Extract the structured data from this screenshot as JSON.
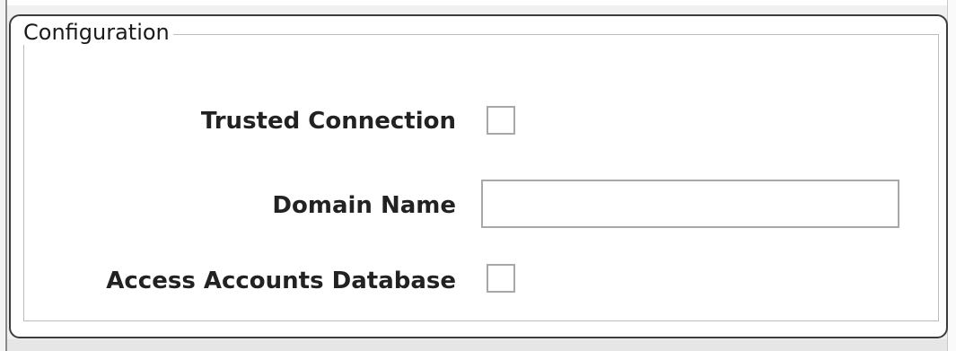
{
  "group": {
    "title": "Configuration"
  },
  "fields": {
    "trusted_connection": {
      "label": "Trusted Connection",
      "checked": false
    },
    "domain_name": {
      "label": "Domain Name",
      "value": ""
    },
    "access_accounts_database": {
      "label": "Access Accounts Database",
      "checked": false
    }
  },
  "colors": {
    "panel_background": "#ffffff",
    "window_background": "#f0f0f0",
    "frame_border": "#3c3c3c",
    "control_border": "#a8a8a8"
  }
}
